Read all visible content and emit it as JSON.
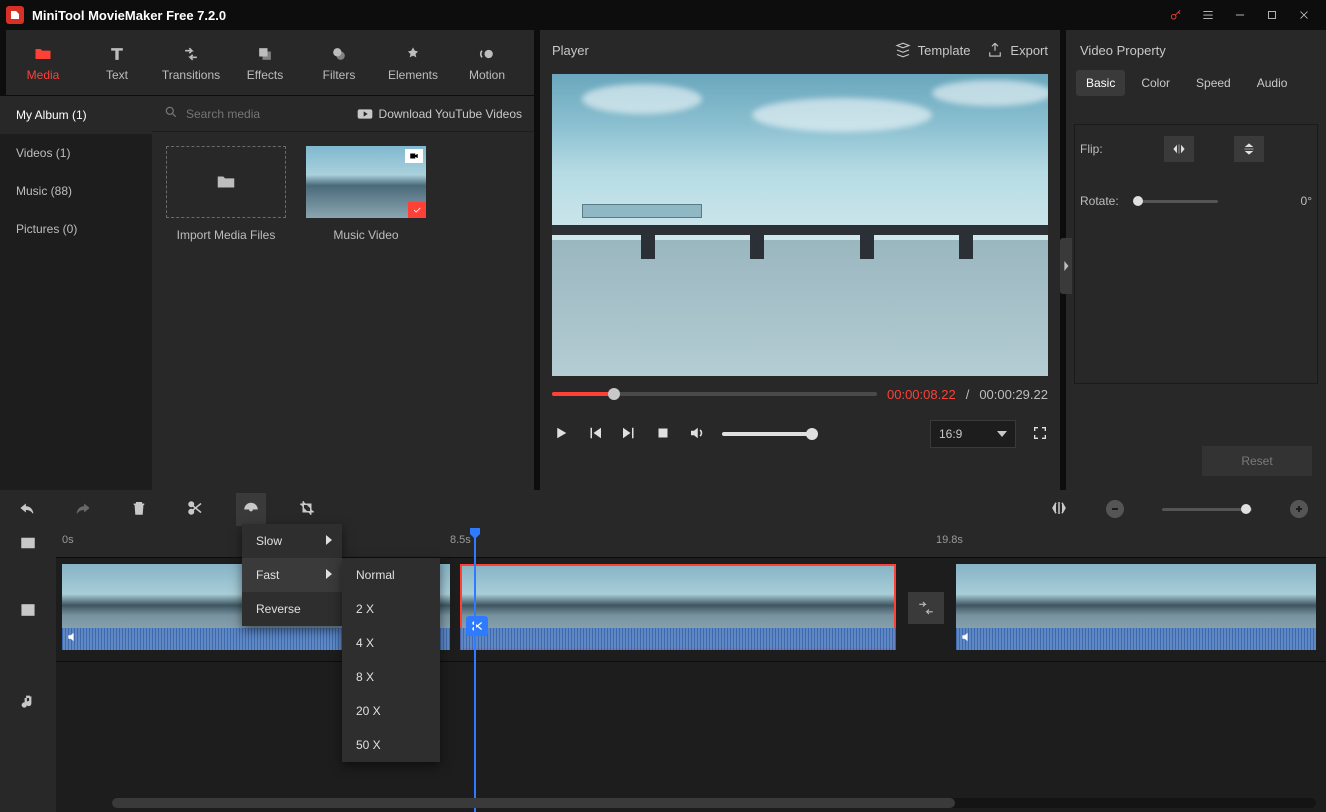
{
  "app": {
    "title": "MiniTool MovieMaker Free 7.2.0"
  },
  "topTabs": {
    "media": "Media",
    "text": "Text",
    "transitions": "Transitions",
    "effects": "Effects",
    "filters": "Filters",
    "elements": "Elements",
    "motion": "Motion"
  },
  "mediaSidebar": {
    "myAlbum": "My Album (1)",
    "videos": "Videos (1)",
    "music": "Music (88)",
    "pictures": "Pictures (0)"
  },
  "mediaContent": {
    "searchPlaceholder": "Search media",
    "downloadYT": "Download YouTube Videos",
    "importLabel": "Import Media Files",
    "clipLabel": "Music Video"
  },
  "player": {
    "title": "Player",
    "template": "Template",
    "export": "Export",
    "cur": "00:00:08.22",
    "sep": "/",
    "tot": "00:00:29.22",
    "aspect": "16:9"
  },
  "propPanel": {
    "title": "Video Property",
    "tabs": {
      "basic": "Basic",
      "color": "Color",
      "speed": "Speed",
      "audio": "Audio"
    },
    "flip": "Flip:",
    "rotate": "Rotate:",
    "rotateVal": "0°",
    "reset": "Reset"
  },
  "timeline": {
    "ruler": {
      "t0": "0s",
      "t1": "8.5s",
      "t2": "19.8s"
    }
  },
  "speedMenu": {
    "slow": "Slow",
    "fast": "Fast",
    "reverse": "Reverse",
    "normal": "Normal",
    "x2": "2 X",
    "x4": "4 X",
    "x8": "8 X",
    "x20": "20 X",
    "x50": "50 X"
  }
}
